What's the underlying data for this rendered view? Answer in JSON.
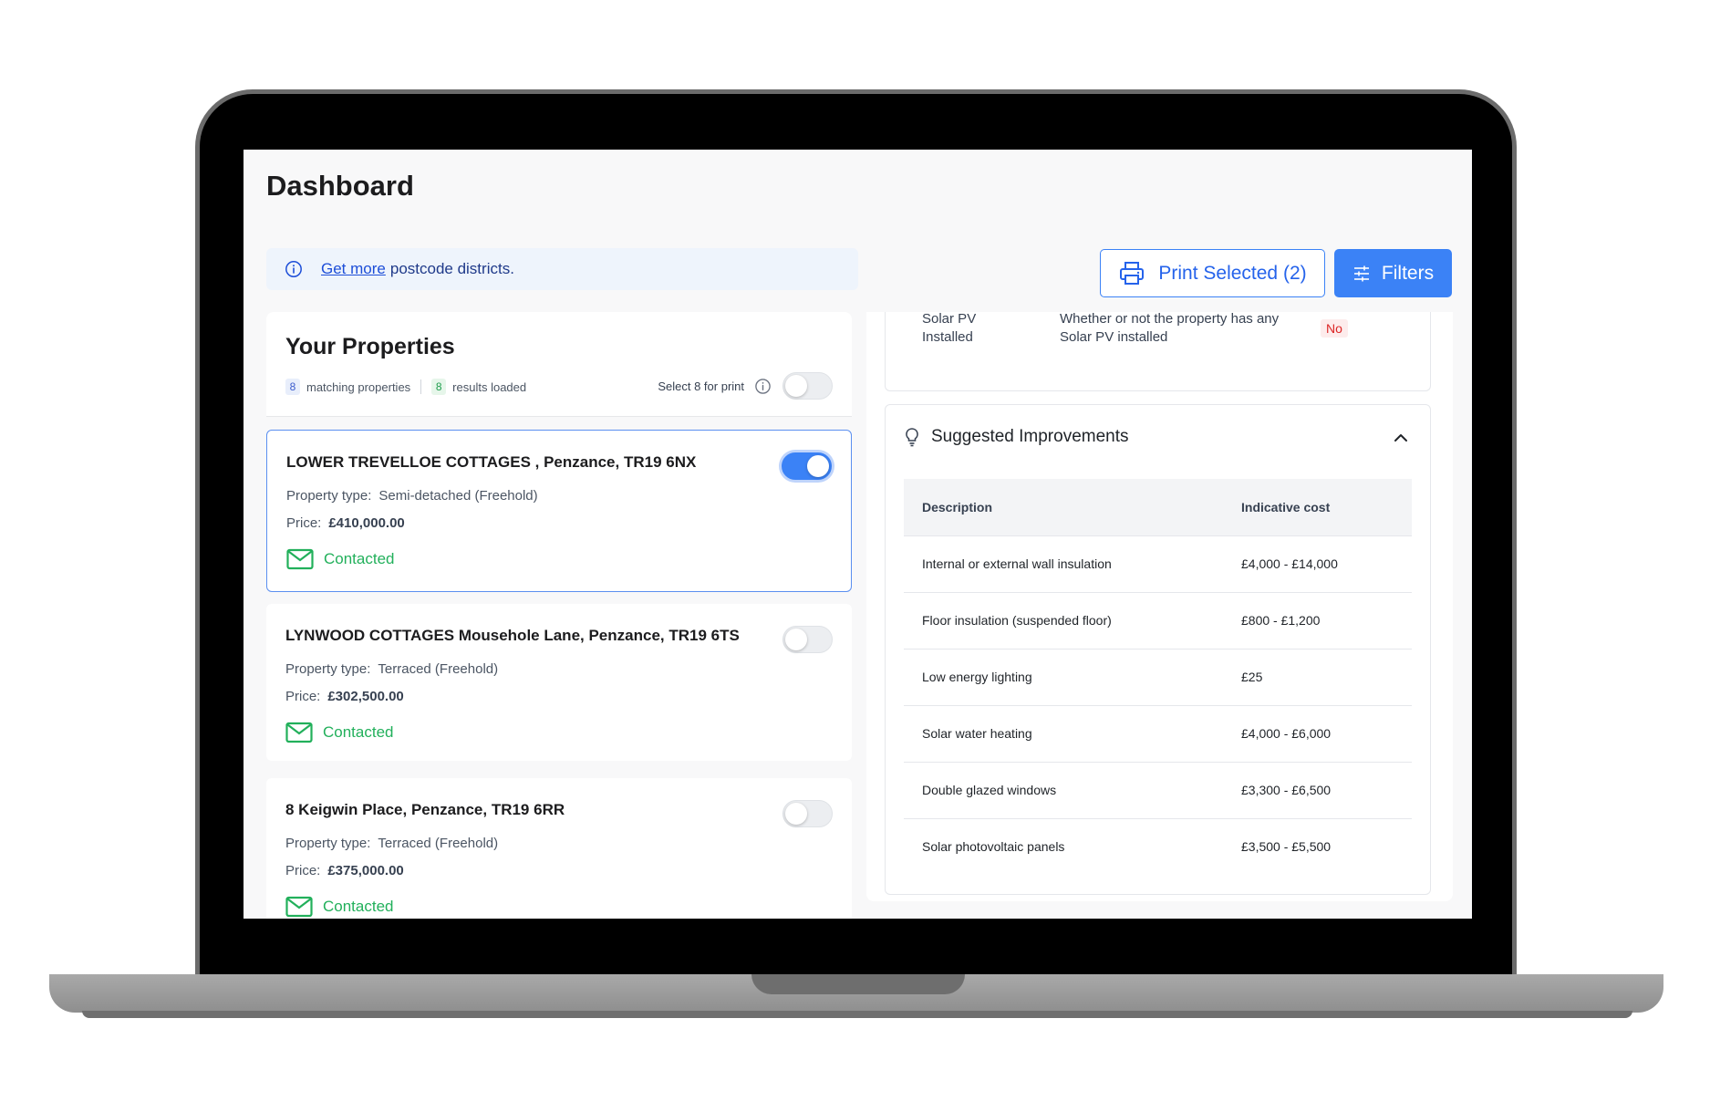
{
  "page": {
    "title": "Dashboard"
  },
  "banner": {
    "link_text": "Get more",
    "text": "postcode districts."
  },
  "toolbar": {
    "print_label": "Print Selected (2)",
    "filters_label": "Filters"
  },
  "properties": {
    "title": "Your Properties",
    "matching_count": "8",
    "matching_label": "matching properties",
    "loaded_count": "8",
    "loaded_label": "results loaded",
    "select_label": "Select 8 for print",
    "type_label": "Property type:",
    "price_label": "Price:",
    "items": [
      {
        "name": "LOWER TREVELLOE COTTAGES , Penzance, TR19 6NX",
        "type": "Semi-detached (Freehold)",
        "price": "£410,000.00",
        "status": "Contacted",
        "selected": true
      },
      {
        "name": "LYNWOOD COTTAGES Mousehole Lane, Penzance, TR19 6TS",
        "type": "Terraced (Freehold)",
        "price": "£302,500.00",
        "status": "Contacted",
        "selected": false
      },
      {
        "name": "8 Keigwin Place, Penzance, TR19 6RR",
        "type": "Terraced (Freehold)",
        "price": "£375,000.00",
        "status": "Contacted",
        "selected": false
      }
    ]
  },
  "solar": {
    "label": "Solar PV Installed",
    "description": "Whether or not the property has any Solar PV installed",
    "value": "No"
  },
  "improvements": {
    "title": "Suggested Improvements",
    "headers": {
      "description": "Description",
      "cost": "Indicative cost"
    },
    "rows": [
      {
        "description": "Internal or external wall insulation",
        "cost": "£4,000 - £14,000"
      },
      {
        "description": "Floor insulation (suspended floor)",
        "cost": "£800 - £1,200"
      },
      {
        "description": "Low energy lighting",
        "cost": "£25"
      },
      {
        "description": "Solar water heating",
        "cost": "£4,000 - £6,000"
      },
      {
        "description": "Double glazed windows",
        "cost": "£3,300 - £6,500"
      },
      {
        "description": "Solar photovoltaic panels",
        "cost": "£3,500 - £5,500"
      }
    ]
  },
  "colors": {
    "accent": "#3b82f6",
    "contacted": "#22b05b",
    "no_badge": "#dc2626"
  },
  "icons": [
    "info-icon",
    "printer-icon",
    "sliders-icon",
    "mail-icon",
    "lightbulb-icon",
    "chevron-up-icon"
  ]
}
